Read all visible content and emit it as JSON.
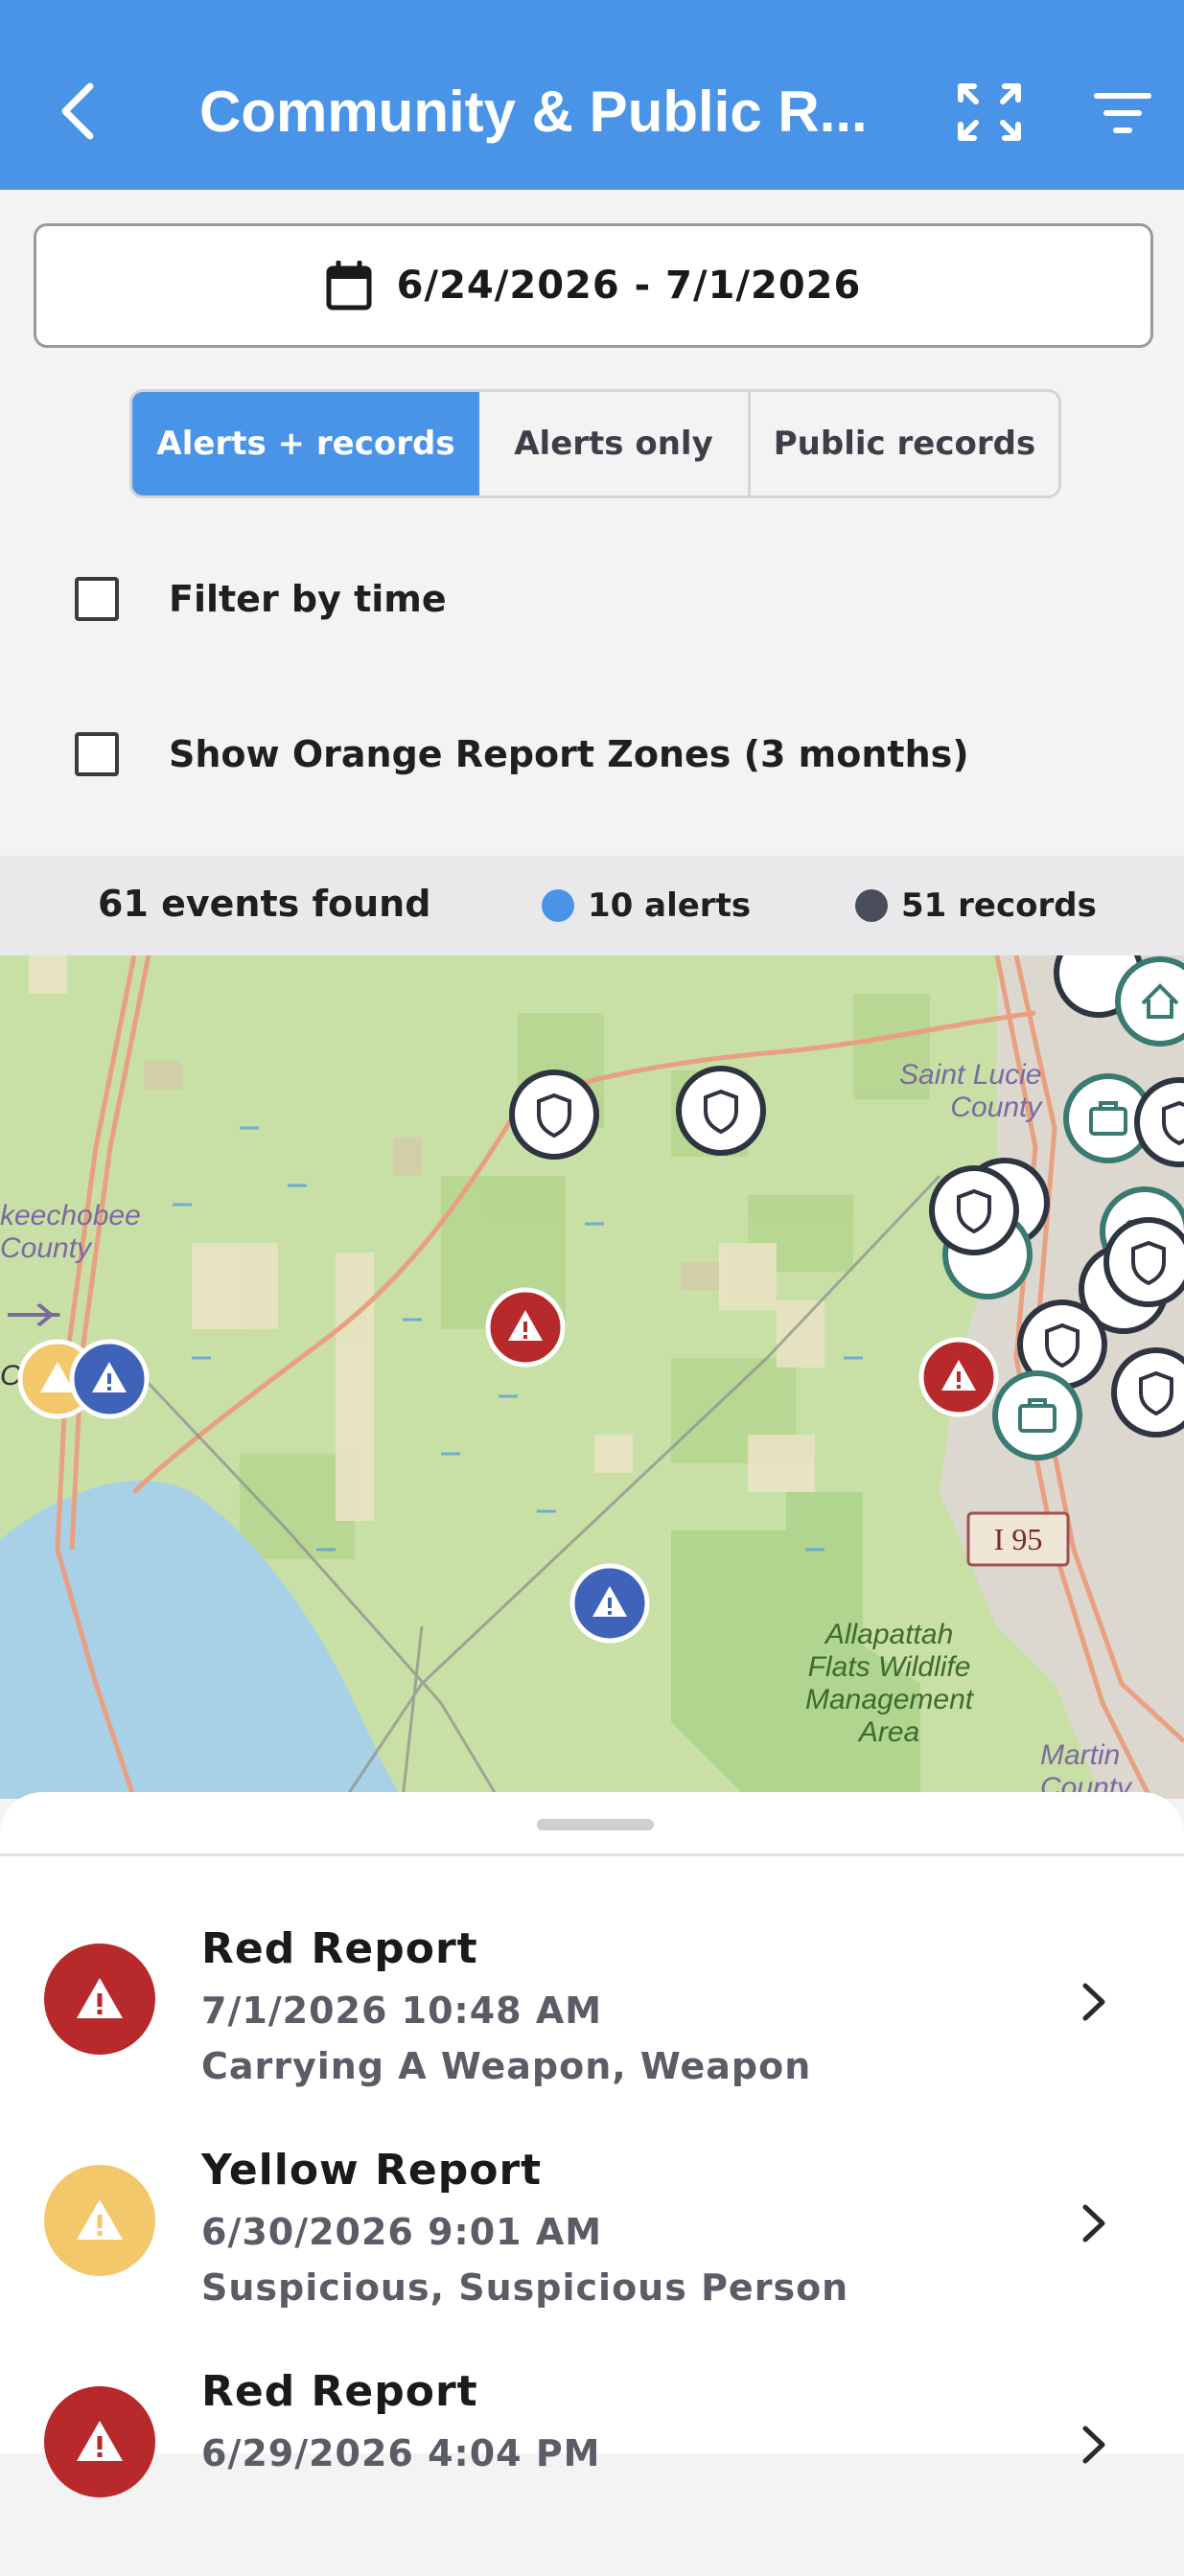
{
  "header": {
    "title": "Community & Public R...",
    "back_icon": "chevron-left-icon",
    "expand_icon": "expand-icon",
    "filter_icon": "filter-icon",
    "bg_color": "#4a94e8"
  },
  "date_range": {
    "label": "6/24/2026 - 7/1/2026",
    "icon": "calendar-icon"
  },
  "segments": [
    {
      "label": "Alerts + records",
      "selected": true
    },
    {
      "label": "Alerts only",
      "selected": false
    },
    {
      "label": "Public records",
      "selected": false
    }
  ],
  "filters": {
    "filter_by_time": {
      "label": "Filter by time",
      "checked": false
    },
    "orange_zones": {
      "label": "Show Orange Report Zones (3 months)",
      "checked": false
    }
  },
  "summary": {
    "events": "61 events found",
    "alerts": "10 alerts",
    "records": "51 records",
    "alerts_color": "#4a94e8",
    "records_color": "#4a4e5a"
  },
  "map": {
    "labels": {
      "saint_lucie": "Saint Lucie\nCounty",
      "okeechobee": "keechobee\nCounty",
      "okee_town": "Ok",
      "i95": "I 95",
      "allapattah": "Allapattah\nFlats Wildlife\nManagement\nArea",
      "martin": "Martin\nCounty"
    }
  },
  "reports": [
    {
      "title": "Red Report",
      "datetime": "7/1/2026 10:48 AM",
      "detail": "Carrying A Weapon, Weapon",
      "color": "#b8292b",
      "icon": "warning-icon"
    },
    {
      "title": "Yellow Report",
      "datetime": "6/30/2026 9:01 AM",
      "detail": "Suspicious, Suspicious Person",
      "color": "#f3c86a",
      "icon": "warning-icon"
    },
    {
      "title": "Red Report",
      "datetime": "6/29/2026 4:04 PM",
      "detail": "",
      "color": "#b8292b",
      "icon": "warning-icon"
    }
  ]
}
